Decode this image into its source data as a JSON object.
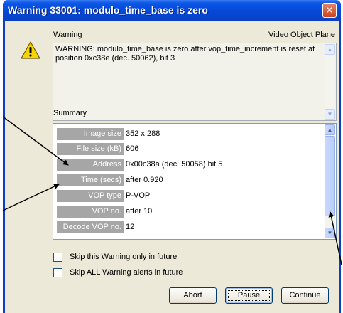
{
  "window": {
    "title": "Warning 33001: modulo_time_base is zero",
    "close_glyph": "✕"
  },
  "warning": {
    "heading": "Warning",
    "context": "Video Object Plane",
    "message": "WARNING: modulo_time_base is zero after vop_time_increment is reset at position 0xc38e (dec. 50062), bit 3"
  },
  "summary": {
    "heading": "Summary",
    "rows": [
      {
        "key": "Image size",
        "value": "352 x 288"
      },
      {
        "key": "File size (kB)",
        "value": "606"
      },
      {
        "key": "Address",
        "value": "0x00c38a (dec. 50058) bit 5"
      },
      {
        "key": "Time (secs)",
        "value": "after 0.920"
      },
      {
        "key": "VOP type",
        "value": "P-VOP"
      },
      {
        "key": "VOP no.",
        "value": "after 10"
      },
      {
        "key": "Decode VOP no.",
        "value": "12"
      }
    ]
  },
  "options": {
    "skip_this": "Skip this Warning only in future",
    "skip_all": "Skip ALL Warning alerts in future"
  },
  "buttons": {
    "abort": "Abort",
    "pause": "Pause",
    "continue": "Continue"
  },
  "colors": {
    "titlebar": "#0a56e6",
    "dialog_bg": "#ece9d8",
    "key_label_bg": "#a6a6a6",
    "warning_icon": "#f5d400",
    "annotation_arrows": "#000000"
  },
  "icons": {
    "warning": "warning-triangle-icon",
    "close": "close-icon"
  }
}
